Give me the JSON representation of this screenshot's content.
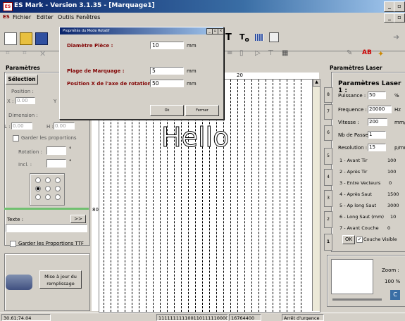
{
  "window": {
    "title": "ES Mark - Version 3.1.35 - [Marquage1]",
    "app_icon": "ES"
  },
  "menu": [
    "Fichier",
    "Editer",
    "Outils",
    "Fenêtres"
  ],
  "left_panel": {
    "title": "Paramètres",
    "tab": "Sélection",
    "position_label": "Position :",
    "x_label": "X :",
    "x_value": "0.00",
    "y_label": "Y",
    "dimension_label": "Dimension :",
    "l_label": "L :",
    "l_value": "0.00",
    "h_label": "H :",
    "h_value": "0.00",
    "keep_proportions": "Garder les proportions",
    "rotation_label": "Rotation :",
    "incl_label": "Incl. :",
    "degree": "°",
    "text_label": "Texte :",
    "text_btn": ">>",
    "keep_ttf": "Garder les Proportions TTF",
    "update_btn": "Mise à jour du remplissage"
  },
  "canvas": {
    "text": "Hello",
    "ruler_top_label": "20",
    "ruler_left_label": "80"
  },
  "right_panel": {
    "title": "Paramètres Laser",
    "subtitle": "Paramètres Laser 1 :",
    "puissance_label": "Puissance :",
    "puissance_value": "50",
    "puissance_unit": "%",
    "frequence_label": "Frequence :",
    "frequence_value": "20000",
    "frequence_unit": "Hz",
    "vitesse_label": "Vitesse :",
    "vitesse_value": "200",
    "vitesse_unit": "mm/s",
    "passes_label": "Nb de Passe :",
    "passes_value": "1",
    "resolution_label": "Resolution :",
    "resolution_value": "15",
    "resolution_unit": "p/mm",
    "delays": [
      {
        "label": "1 - Avant Tir",
        "value": "100"
      },
      {
        "label": "2 - Après Tir",
        "value": "100"
      },
      {
        "label": "3 - Entre Vecteurs",
        "value": "0"
      },
      {
        "label": "4 - Après Saut",
        "value": "1500"
      },
      {
        "label": "5 - Ap long Saut",
        "value": "3000"
      },
      {
        "label": "6 - Long Saut (mm)",
        "value": "10"
      },
      {
        "label": "7 - Avant Couche",
        "value": "0"
      }
    ],
    "tab_numbers": [
      "8",
      "7",
      "6",
      "5",
      "4",
      "3",
      "2",
      "1"
    ],
    "ok_btn": "OK",
    "visible_layer": "Couche Visible",
    "zoom_label": "Zoom :",
    "zoom_value": "100 %"
  },
  "status_bar": {
    "coords": "30.61;74.04",
    "bits": "111111111100110111110000",
    "value": "16764400",
    "emergency": "Arrêt d'urgence"
  },
  "dialog": {
    "title": "Propriétés du Mode Rotatif",
    "diameter_label": "Diamètre Pièce :",
    "diameter_value": "10",
    "range_label": "Plage de Marquage :",
    "range_value": "5",
    "pos_label": "Position X de l'axe de rotation :",
    "pos_value": "50",
    "unit": "mm",
    "ok": "Ok",
    "close": "Fermer"
  },
  "colors": {
    "accent": "#0a246a",
    "dialog_label": "#800000",
    "canvas_text": "#000000"
  }
}
